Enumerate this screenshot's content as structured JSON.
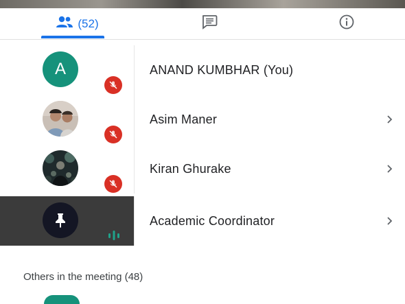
{
  "tabs": [
    {
      "name": "people",
      "count": "(52)",
      "icon": "people-icon",
      "active": true
    },
    {
      "name": "chat",
      "icon": "chat-icon"
    },
    {
      "name": "info",
      "icon": "info-icon"
    }
  ],
  "participants": [
    {
      "name": "ANAND KUMBHAR (You)",
      "avatar_letter": "A",
      "status": "muted",
      "chevron": false
    },
    {
      "name": "Asim Maner",
      "avatar": "photo",
      "status": "muted",
      "chevron": true
    },
    {
      "name": "Kiran Ghurake",
      "avatar": "photo",
      "status": "muted",
      "chevron": true
    },
    {
      "name": "Academic Coordinator",
      "avatar": "pin-icon",
      "status": "speaking",
      "chevron": true,
      "highlighted": true
    }
  ],
  "others_section": {
    "title": "Others in the meeting (48)"
  },
  "colors": {
    "accent": "#1a73e8",
    "mute_red": "#d93025",
    "avatar_teal": "#16927b",
    "speaking_teal": "#1fa38b",
    "highlight_bg": "#3b3b3b"
  }
}
